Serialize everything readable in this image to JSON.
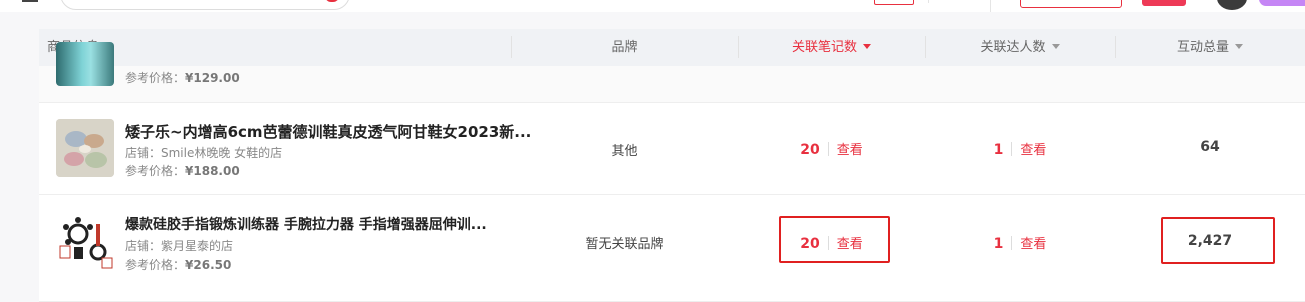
{
  "table": {
    "headers": {
      "product": "商品信息",
      "brand": "品牌",
      "notes": "关联笔记数",
      "creators": "关联达人数",
      "interactions": "互动总量"
    },
    "partial_row": {
      "price_label": "参考价格：",
      "price": "¥129.00"
    },
    "rows": [
      {
        "title": "矮子乐~内增高6cm芭蕾德训鞋真皮透气阿甘鞋女2023新...",
        "shop": "店铺：Smile林晚晚 女鞋的店",
        "price_label": "参考价格：",
        "price": "¥188.00",
        "brand": "其他",
        "notes": "20",
        "creators": "1",
        "interactions": "64",
        "view": "查看"
      },
      {
        "title": "爆款硅胶手指锻炼训练器 手腕拉力器 手指增强器屈伸训...",
        "shop": "店铺：紫月星泰的店",
        "price_label": "参考价格：",
        "price": "¥26.50",
        "brand": "暂无关联品牌",
        "notes": "20",
        "creators": "1",
        "interactions": "2,427",
        "view": "查看"
      }
    ]
  },
  "colors": {
    "accent": "#e8303f",
    "header_bg": "#f0f2f5",
    "highlight": "#e02020"
  },
  "icons": [
    "menu-icon",
    "search-icon",
    "sort-desc-icon",
    "sort-icon"
  ]
}
